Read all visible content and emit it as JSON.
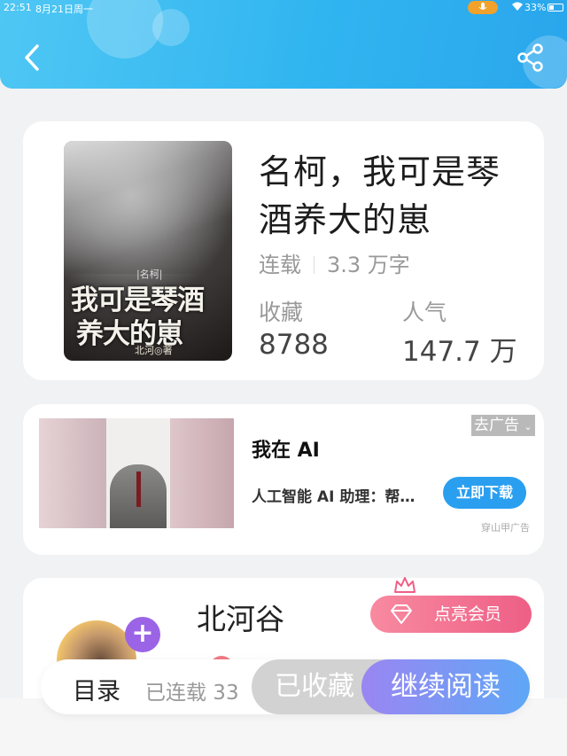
{
  "status": {
    "time": "22:51",
    "date": "8月21日周一",
    "battery": "33%"
  },
  "book": {
    "title": "名柯，我可是琴酒养大的崽",
    "status": "连载",
    "words": "3.3 万字",
    "collect_label": "收藏",
    "collect_value": "8788",
    "popularity_label": "人气",
    "popularity_value": "147.7 万",
    "cover": {
      "tag": "|名柯|",
      "line1": "我可是琴酒",
      "line2": "养大的崽",
      "author": "北河◎著"
    }
  },
  "ad": {
    "title": "我在 AI",
    "desc": "人工智能 AI 助理：帮…",
    "button": "立即下载",
    "close": "去广告",
    "source": "穿山甲广告"
  },
  "author": {
    "name": "北河谷",
    "vip_button": "点亮会员"
  },
  "bottom": {
    "toc": "目录",
    "serial": "已连载 33",
    "collected": "已收藏",
    "read": "继续阅读"
  },
  "colors": {
    "header": "#31b5f0",
    "download": "#2a9ff0",
    "vip": "#ee5f86",
    "plus": "#9b64e6"
  }
}
